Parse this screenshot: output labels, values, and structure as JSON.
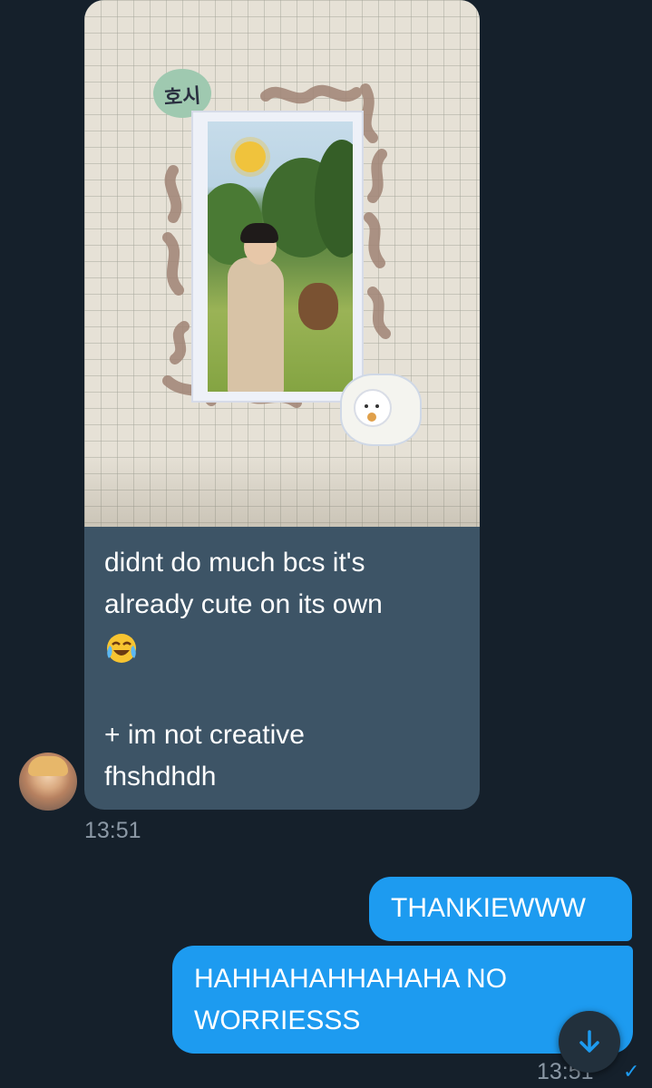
{
  "colors": {
    "background": "#15202b",
    "incoming_bubble": "#3d5466",
    "outgoing_bubble": "#1d9bf0",
    "timestamp": "#8b98a5",
    "read_check": "#1d9bf0"
  },
  "incoming": {
    "image_sticker_text": "호시",
    "caption_lines": [
      "didnt do much bcs it's",
      "already cute on its own"
    ],
    "caption_emoji": "face-with-tears-of-joy-icon",
    "caption_lines_2": [
      "+ im not creative",
      "fhshdhdh"
    ],
    "time": "13:51"
  },
  "outgoing": {
    "messages": [
      {
        "text": "THANKIEWWW"
      },
      {
        "text": "HAHHAHAHHAHAHA NO WORRIESSS"
      }
    ],
    "time": "13:51"
  }
}
